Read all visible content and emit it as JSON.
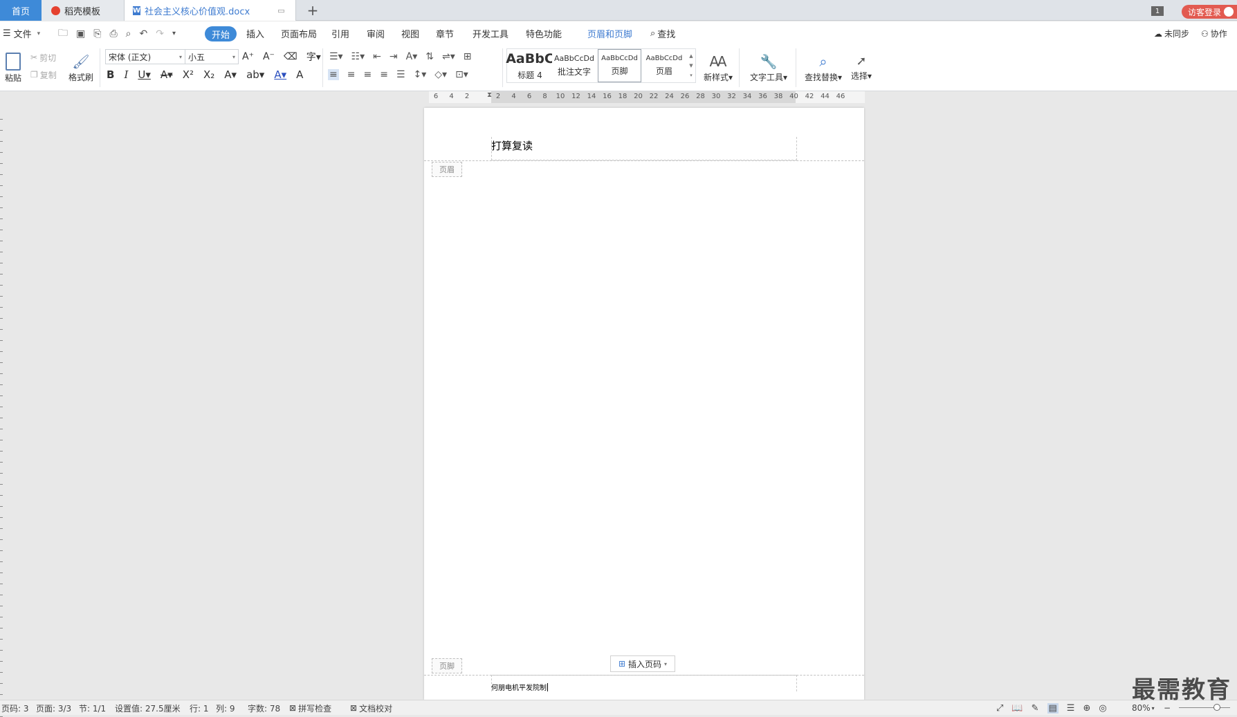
{
  "tabs": {
    "home": "首页",
    "template": "稻壳模板",
    "document": "社会主义核心价值观.docx",
    "plus": "+"
  },
  "topright": {
    "badge": "1",
    "login": "访客登录"
  },
  "menu": {
    "file": "文件",
    "items": [
      "开始",
      "插入",
      "页面布局",
      "引用",
      "审阅",
      "视图",
      "章节",
      "开发工具",
      "特色功能"
    ],
    "header_footer": "页眉和页脚",
    "find": "查找",
    "sync": "未同步",
    "collab": "协作"
  },
  "ribbon": {
    "paste": "粘贴",
    "cut": "剪切",
    "copy": "复制",
    "format_painter": "格式刷",
    "font_name": "宋体 (正文)",
    "font_size": "小五",
    "styles": [
      {
        "sample": "AaBbC",
        "name": "标题 4"
      },
      {
        "sample": "AaBbCcDd",
        "name": "批注文字"
      },
      {
        "sample": "AaBbCcDd",
        "name": "页脚"
      },
      {
        "sample": "AaBbCcDd",
        "name": "页眉"
      }
    ],
    "new_style": "新样式",
    "text_tools": "文字工具",
    "find_replace": "查找替换",
    "select": "选择"
  },
  "ruler": {
    "ticks": [
      "6",
      "4",
      "2",
      "",
      "2",
      "4",
      "6",
      "8",
      "10",
      "12",
      "14",
      "16",
      "18",
      "20",
      "22",
      "24",
      "26",
      "28",
      "30",
      "32",
      "34",
      "36",
      "38",
      "40",
      "42",
      "44",
      "46"
    ]
  },
  "document": {
    "header_text": "打算复读",
    "header_tag": "页眉",
    "footer_tag": "页脚",
    "insert_page_number": "插入页码",
    "footer_text": "何朋电机平发院制"
  },
  "status": {
    "page_code": "页码: 3",
    "page": "页面: 3/3",
    "section": "节: 1/1",
    "setting": "设置值: 27.5厘米",
    "row": "行: 1",
    "col": "列: 9",
    "chars": "字数: 78",
    "spell": "拼写检查",
    "proof": "文档校对",
    "zoom": "80%"
  },
  "watermark": "最需教育"
}
